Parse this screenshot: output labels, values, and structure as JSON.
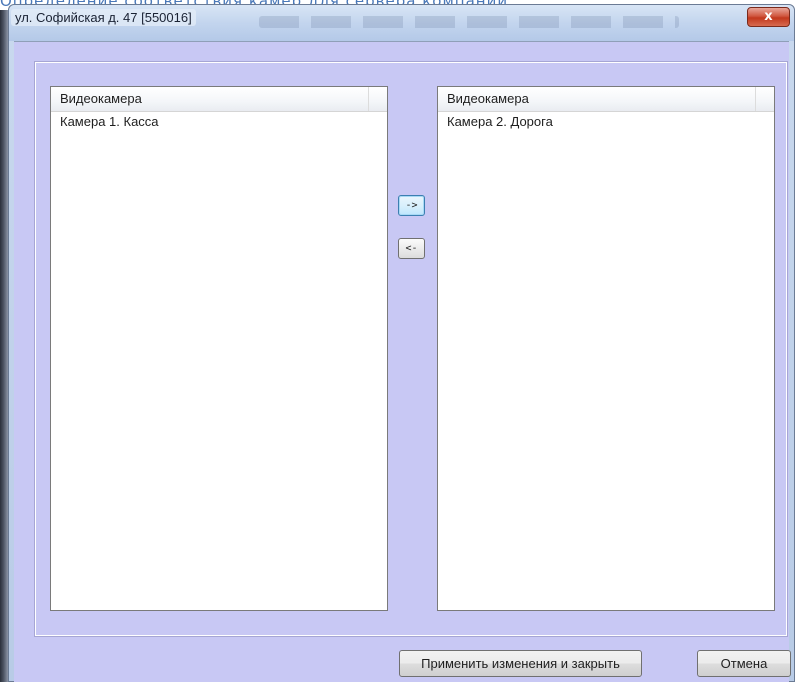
{
  "background": {
    "partial_text": "Определение соответствия камер для сервера компаний"
  },
  "window": {
    "title": "ул. Софийская д. 47 [550016]",
    "close_label": "x"
  },
  "left_list": {
    "column_header": "Видеокамера",
    "items": [
      "Камера 1. Касса"
    ]
  },
  "right_list": {
    "column_header": "Видеокамера",
    "items": [
      "Камера 2. Дорога"
    ]
  },
  "move_buttons": {
    "move_right_label": "->",
    "move_left_label": "<-"
  },
  "footer": {
    "apply_label": "Применить изменения и закрыть",
    "cancel_label": "Отмена"
  },
  "colors": {
    "client_background": "#c8c8f4",
    "close_button": "#c2381d",
    "background_text": "#4a78b8"
  }
}
